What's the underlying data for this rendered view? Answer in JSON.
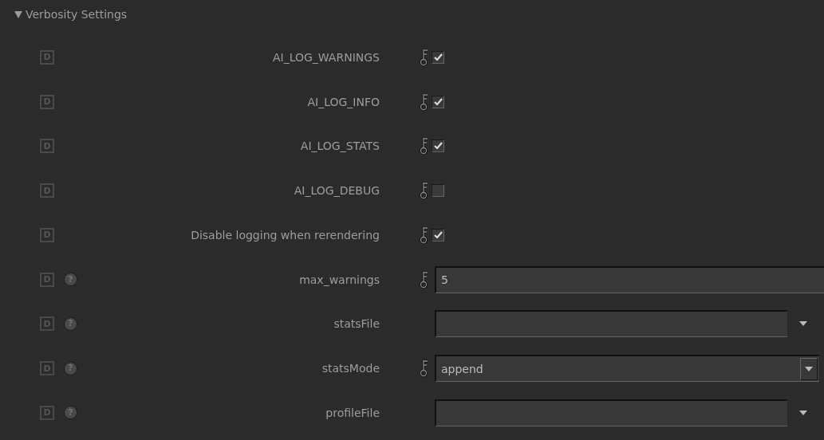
{
  "section": {
    "title": "Verbosity Settings",
    "expanded": true
  },
  "params": [
    {
      "kind": "checkbox",
      "default_button": "D",
      "label": "AI_LOG_WARNINGS",
      "keyframe": true,
      "checked": true
    },
    {
      "kind": "checkbox",
      "default_button": "D",
      "label": "AI_LOG_INFO",
      "keyframe": true,
      "checked": true
    },
    {
      "kind": "checkbox",
      "default_button": "D",
      "label": "AI_LOG_STATS",
      "keyframe": true,
      "checked": true
    },
    {
      "kind": "checkbox",
      "default_button": "D",
      "label": "AI_LOG_DEBUG",
      "keyframe": true,
      "checked": false
    },
    {
      "kind": "checkbox",
      "default_button": "D",
      "label": "Disable logging when rerendering",
      "keyframe": true,
      "checked": true
    },
    {
      "kind": "number",
      "default_button": "D",
      "help": "?",
      "label": "max_warnings",
      "keyframe": true,
      "value": "5"
    },
    {
      "kind": "file",
      "default_button": "D",
      "help": "?",
      "label": "statsFile",
      "keyframe": false
    },
    {
      "kind": "combo",
      "default_button": "D",
      "help": "?",
      "label": "statsMode",
      "keyframe": true,
      "value": "append"
    },
    {
      "kind": "file",
      "default_button": "D",
      "help": "?",
      "label": "profileFile",
      "keyframe": false
    }
  ]
}
